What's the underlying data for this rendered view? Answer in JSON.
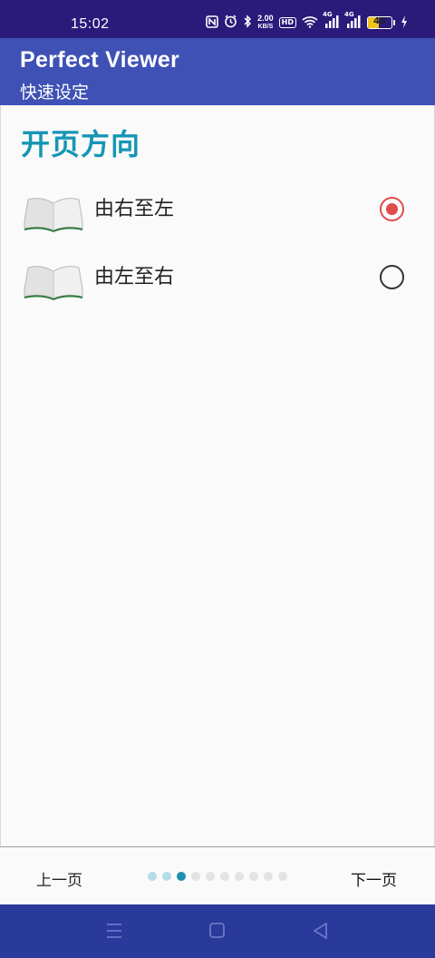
{
  "status_bar": {
    "time": "15:02",
    "net_speed_value": "2.00",
    "net_speed_unit": "KB/S",
    "hd_label": "HD",
    "signal_label_1": "4G",
    "signal_label_2": "4G",
    "battery_level": "45",
    "battery_fraction": 0.45,
    "icons": [
      "nfc-icon",
      "alarm-icon",
      "bluetooth-icon",
      "wifi-icon",
      "signal-icon",
      "battery-icon",
      "charging-icon"
    ]
  },
  "app_bar": {
    "title": "Perfect Viewer",
    "subtitle": "快速设定"
  },
  "page": {
    "heading": "开页方向",
    "options": [
      {
        "label": "由右至左",
        "selected": true,
        "icon": "open-book-icon"
      },
      {
        "label": "由左至右",
        "selected": false,
        "icon": "open-book-icon"
      }
    ]
  },
  "bottom_nav": {
    "prev_label": "上一页",
    "next_label": "下一页",
    "total_pages": 10,
    "current_page": 3
  },
  "colors": {
    "status_bar": "#2a1a7a",
    "app_bar": "#3f51b5",
    "heading": "#1596b5",
    "radio_selected": "#e04b4b",
    "dot_current": "#1a8fb0",
    "system_nav": "#2a3a9a"
  },
  "system_nav": {
    "icons": [
      "menu-icon",
      "home-icon",
      "back-icon"
    ]
  }
}
